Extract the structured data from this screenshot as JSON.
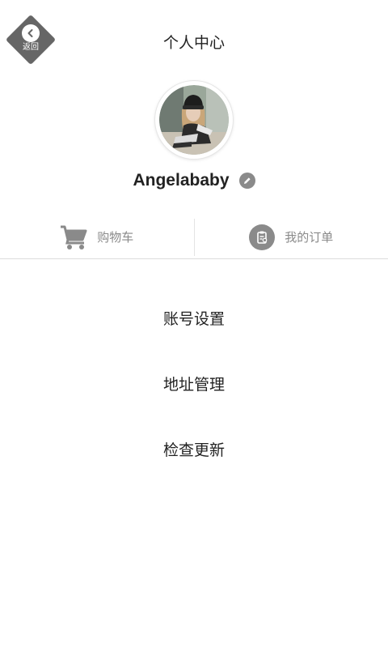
{
  "header": {
    "back_label": "返回",
    "title": "个人中心"
  },
  "profile": {
    "username": "Angelababy"
  },
  "quick_actions": [
    {
      "label": "购物车",
      "icon": "cart-icon"
    },
    {
      "label": "我的订单",
      "icon": "order-clipboard-icon"
    }
  ],
  "menu": [
    {
      "label": "账号设置"
    },
    {
      "label": "地址管理"
    },
    {
      "label": "检查更新"
    }
  ],
  "colors": {
    "icon_gray": "#8a8a8a",
    "back_badge": "#666666",
    "text": "#222222",
    "divider": "#dcdcdc"
  }
}
